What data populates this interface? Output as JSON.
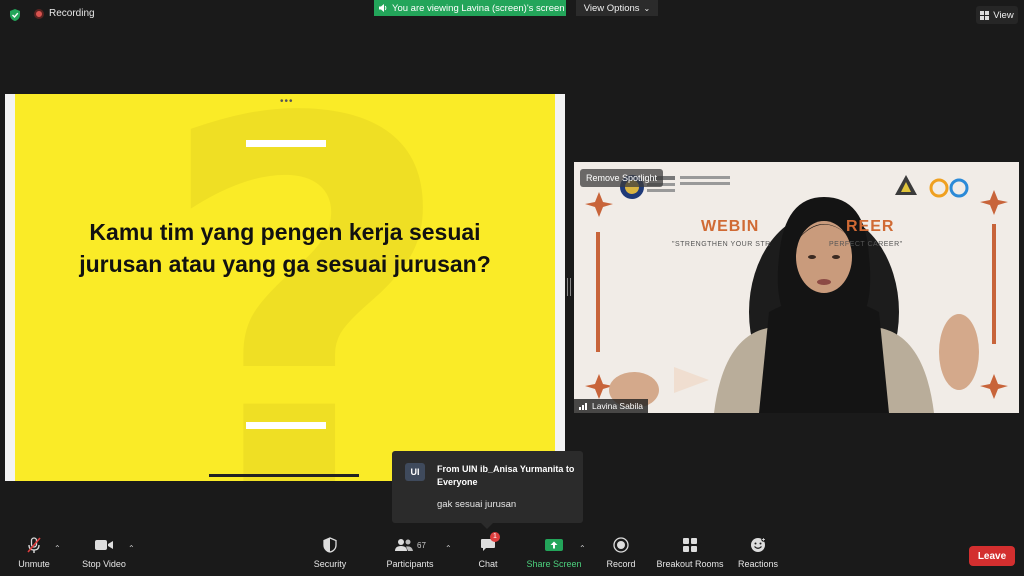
{
  "top": {
    "recording_label": "Recording",
    "viewing_banner": "You are viewing Lavina (screen)'s screen",
    "view_options_label": "View Options",
    "view_label": "View"
  },
  "slide": {
    "question": "Kamu tim yang pengen kerja sesuai jurusan atau yang ga sesuai jurusan?",
    "more_dots": "•••"
  },
  "video": {
    "spotlight_label": "Remove Spotlight",
    "banner_title_left": "WEBIN",
    "banner_title_right": "REER",
    "banner_sub_left": "\"STRENGTHEN YOUR STR",
    "banner_sub_right": "PERFECT CAREER\"",
    "participant_name": "Lavina Sabila"
  },
  "chat_popup": {
    "avatar_initials": "UI",
    "from_line": "From UIN ib_Anisa Yurmanita to Everyone",
    "message": "gak sesuai jurusan"
  },
  "toolbar": {
    "unmute": "Unmute",
    "stop_video": "Stop Video",
    "security": "Security",
    "participants": "Participants",
    "participants_count": "67",
    "chat": "Chat",
    "chat_badge": "1",
    "share_screen": "Share Screen",
    "record": "Record",
    "breakout_rooms": "Breakout Rooms",
    "reactions": "Reactions",
    "leave": "Leave"
  },
  "colors": {
    "slide_bg": "#faeb27",
    "share_green": "#23a55a",
    "leave_red": "#d32f2f"
  }
}
